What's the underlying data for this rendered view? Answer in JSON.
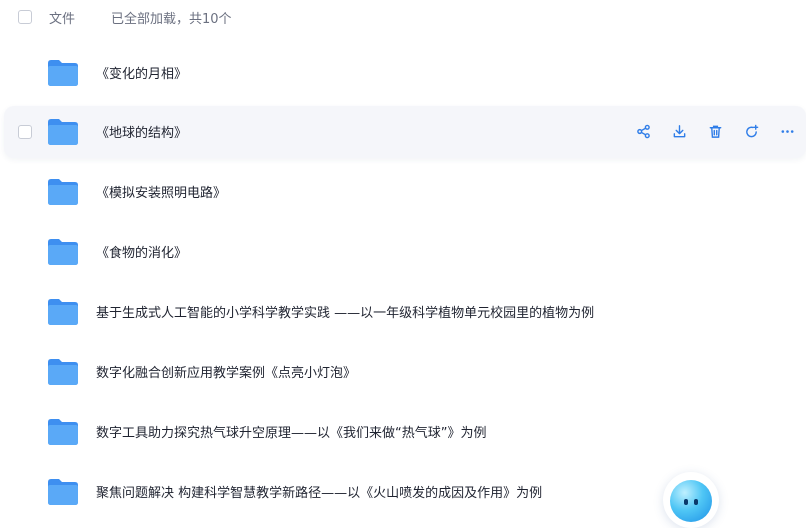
{
  "header": {
    "column_label": "文件",
    "count_text": "已全部加载，共10个"
  },
  "files": [
    {
      "name": "《变化的月相》"
    },
    {
      "name": "《地球的结构》"
    },
    {
      "name": "《模拟安装照明电路》"
    },
    {
      "name": "《食物的消化》"
    },
    {
      "name": "基于生成式人工智能的小学科学教学实践 ——以一年级科学植物单元校园里的植物为例"
    },
    {
      "name": "数字化融合创新应用教学案例《点亮小灯泡》"
    },
    {
      "name": "数字工具助力探究热气球升空原理——以《我们来做“热气球”》为例"
    },
    {
      "name": "聚焦问题解决 构建科学智慧教学新路径——以《火山喷发的成因及作用》为例"
    }
  ],
  "row_actions": [
    "share-icon",
    "download-icon",
    "trash-icon",
    "refresh-icon",
    "more-icon"
  ],
  "colors": {
    "folder": "#5aa9f7",
    "folder_dark": "#3e8ff0",
    "action_icon": "#2f7de8",
    "hover_bg": "#f5f6fa"
  }
}
